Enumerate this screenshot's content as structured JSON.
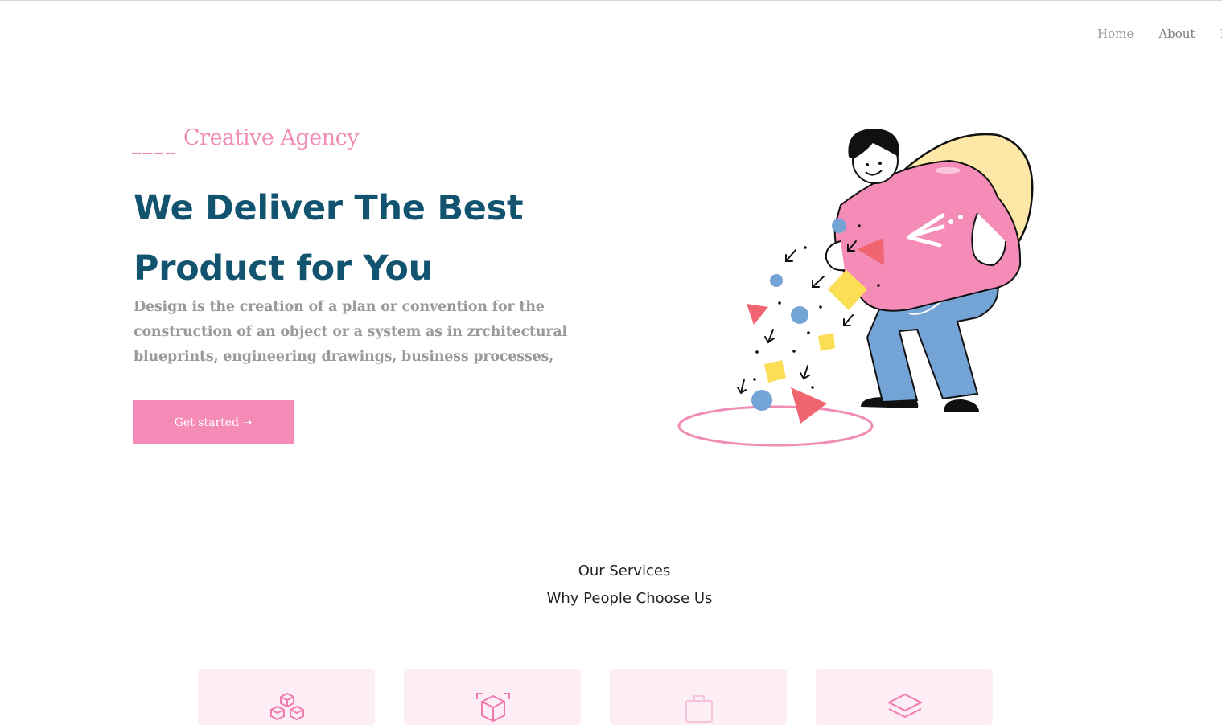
{
  "nav": {
    "items": [
      "Home",
      "About",
      "P"
    ]
  },
  "hero": {
    "eyebrow_dash": "____",
    "eyebrow": "Creative Agency",
    "headline_line1": "We Deliver The Best",
    "headline_line2": "Product for You",
    "description": "Design is the creation of a plan or convention for the construction of an object or a system as in zrchitectural blueprints, engineering drawings, business processes,",
    "cta_label": "Get started ➝"
  },
  "services": {
    "eyebrow": "Our Services",
    "title": "Why People Choose Us",
    "cards": [
      {
        "icon": "cubes-icon"
      },
      {
        "icon": "box-scan-icon"
      },
      {
        "icon": "briefcase-icon"
      },
      {
        "icon": "layers-icon"
      }
    ]
  },
  "colors": {
    "accent_pink": "#f58bb7",
    "headline_blue": "#12546f",
    "muted_text": "#9a9a9a",
    "card_bg": "#fdeef6"
  }
}
